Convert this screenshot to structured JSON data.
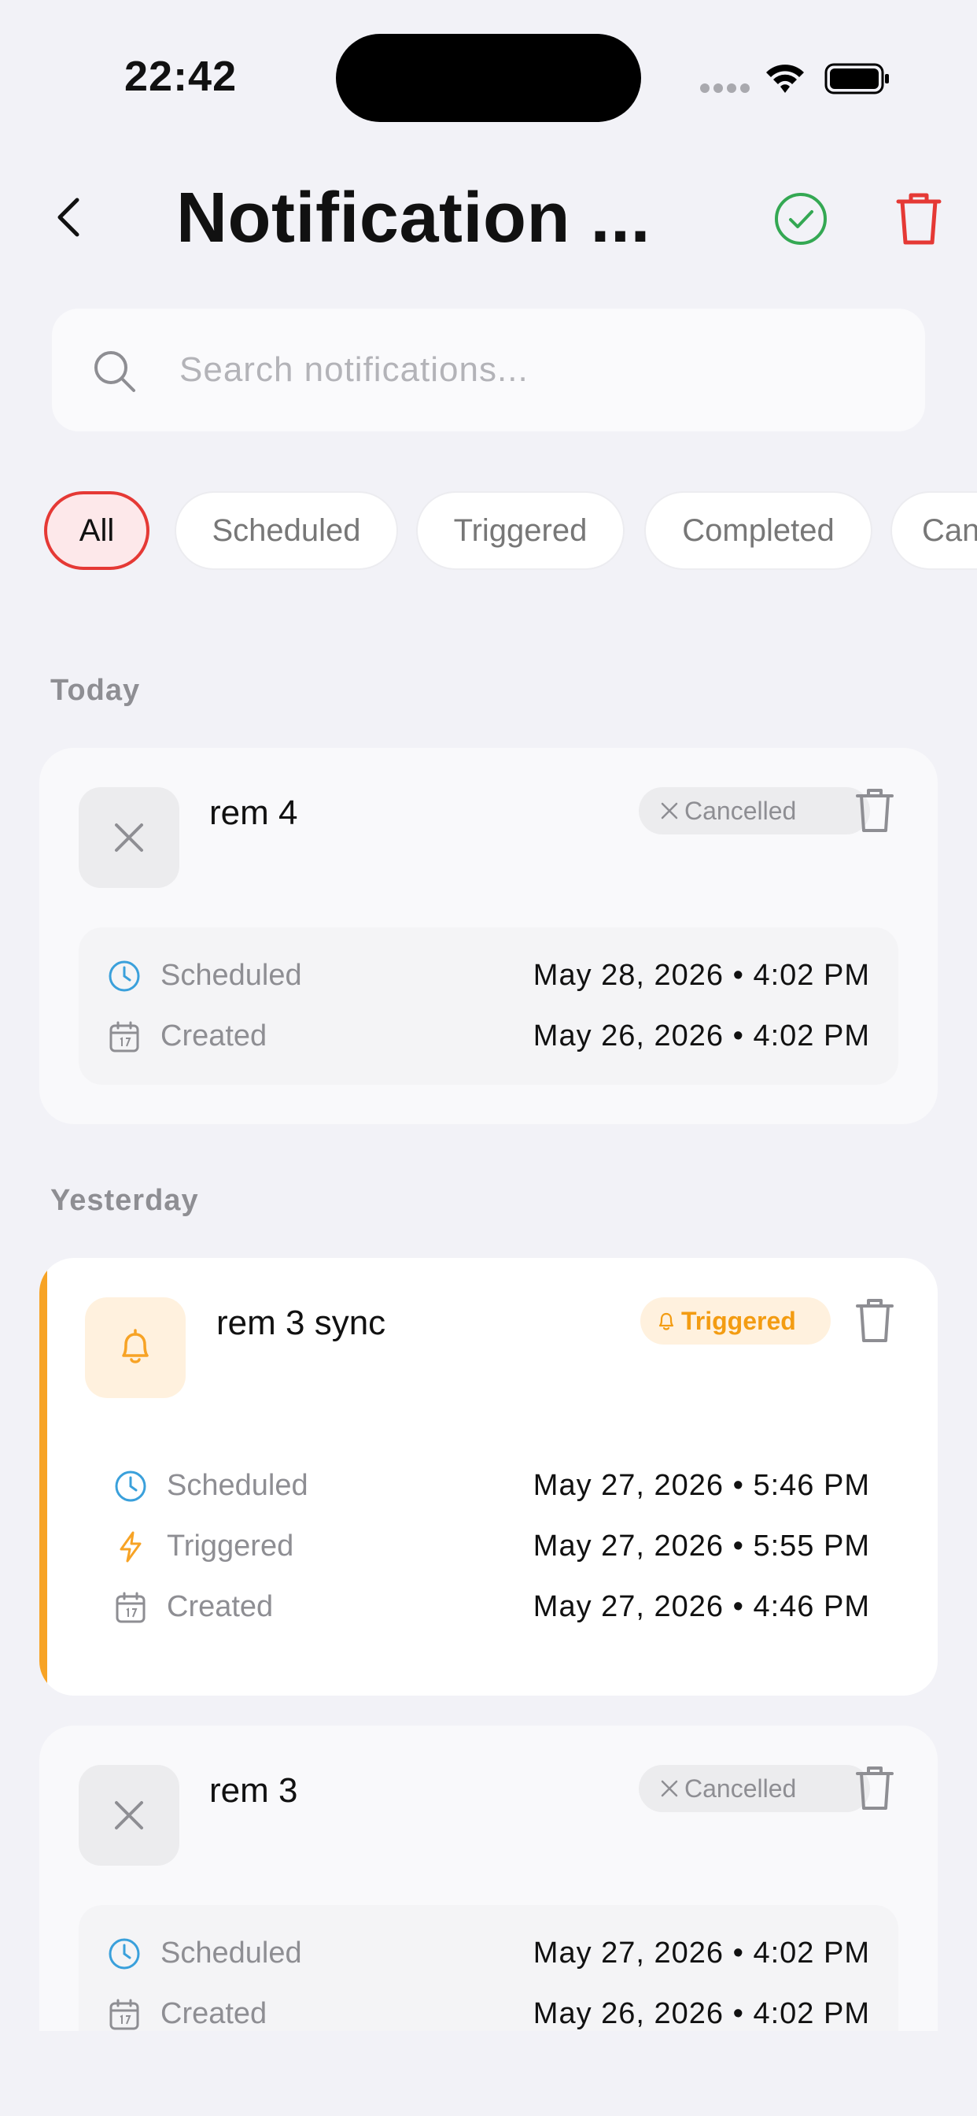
{
  "status_bar": {
    "time": "22:42"
  },
  "header": {
    "title": "Notification ..."
  },
  "search": {
    "placeholder": "Search notifications..."
  },
  "filters": [
    "All",
    "Scheduled",
    "Triggered",
    "Completed",
    "Can"
  ],
  "colors": {
    "accent_red": "#e53935",
    "accent_orange": "#f7a325",
    "accent_green": "#34a853",
    "accent_blue": "#3aa0db"
  },
  "sections": [
    {
      "title": "Today",
      "cards": [
        {
          "title": "rem 4",
          "status": "Cancelled",
          "icon": "close-icon",
          "rows": [
            {
              "icon": "clock-icon",
              "label": "Scheduled",
              "value": "May 28, 2026 • 4:02 PM"
            },
            {
              "icon": "calendar-icon",
              "label": "Created",
              "value": "May 26, 2026 • 4:02 PM"
            }
          ]
        }
      ]
    },
    {
      "title": "Yesterday",
      "cards": [
        {
          "title": "rem 3 sync",
          "status": "Triggered",
          "icon": "bell-icon",
          "rows": [
            {
              "icon": "clock-icon",
              "label": "Scheduled",
              "value": "May 27, 2026 • 5:46 PM"
            },
            {
              "icon": "lightning-icon",
              "label": "Triggered",
              "value": "May 27, 2026 • 5:55 PM"
            },
            {
              "icon": "calendar-icon",
              "label": "Created",
              "value": "May 27, 2026 • 4:46 PM"
            }
          ]
        },
        {
          "title": "rem 3",
          "status": "Cancelled",
          "icon": "close-icon",
          "rows": [
            {
              "icon": "clock-icon",
              "label": "Scheduled",
              "value": "May 27, 2026 • 4:02 PM"
            },
            {
              "icon": "calendar-icon",
              "label": "Created",
              "value": "May 26, 2026 • 4:02 PM"
            }
          ]
        }
      ]
    }
  ]
}
